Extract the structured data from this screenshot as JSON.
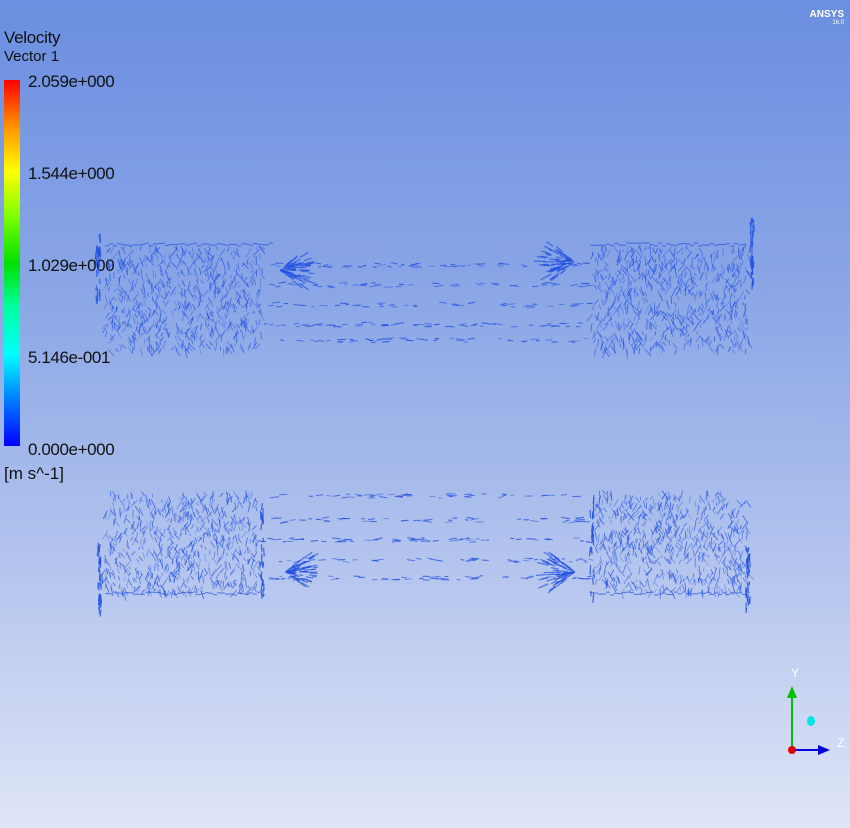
{
  "legend": {
    "title": "Velocity",
    "subtitle": "Vector 1",
    "ticks": [
      "2.059e+000",
      "1.544e+000",
      "1.029e+000",
      "5.146e-001",
      "0.000e+000"
    ],
    "units": "[m s^-1]"
  },
  "branding": {
    "logo": "ANSYS",
    "version": "16.0"
  },
  "axes_triad": {
    "y_label": "Y",
    "z_label": "Z",
    "y_color": "#00c000",
    "z_color": "#0000ff",
    "x_color": "#e00000",
    "vertical_color": "#00e5e5"
  },
  "colors": {
    "vector_color": "#1f4fe0",
    "background_top": "#6b8ee0",
    "background_bottom": "#dfe5f7"
  }
}
